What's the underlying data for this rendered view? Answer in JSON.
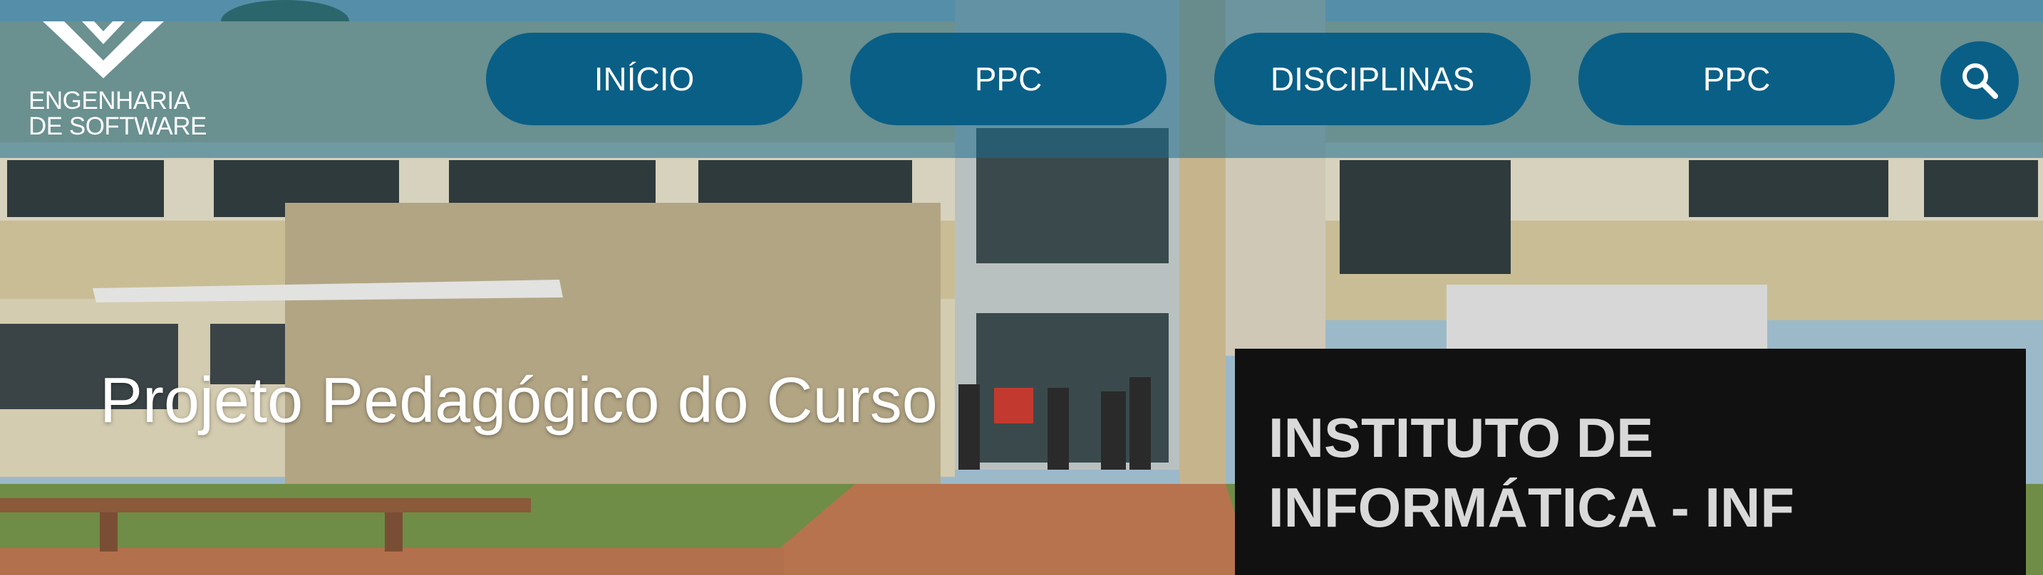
{
  "logo": {
    "line1": "ENGENHARIA",
    "line2": "DE SOFTWARE",
    "icon": "brand-chevron-icon"
  },
  "nav": {
    "items": [
      {
        "label": "INÍCIO"
      },
      {
        "label": "PPC"
      },
      {
        "label": "DISCIPLINAS"
      },
      {
        "label": "PPC"
      }
    ],
    "search_icon": "search-icon"
  },
  "hero": {
    "title": "Projeto Pedagógico do Curso",
    "sign_line1": "INSTITUTO DE",
    "sign_line2": "INFORMÁTICA - INF"
  },
  "colors": {
    "header_overlay": "#1b6c8c",
    "button_bg": "#0a5f86",
    "text": "#ffffff"
  }
}
